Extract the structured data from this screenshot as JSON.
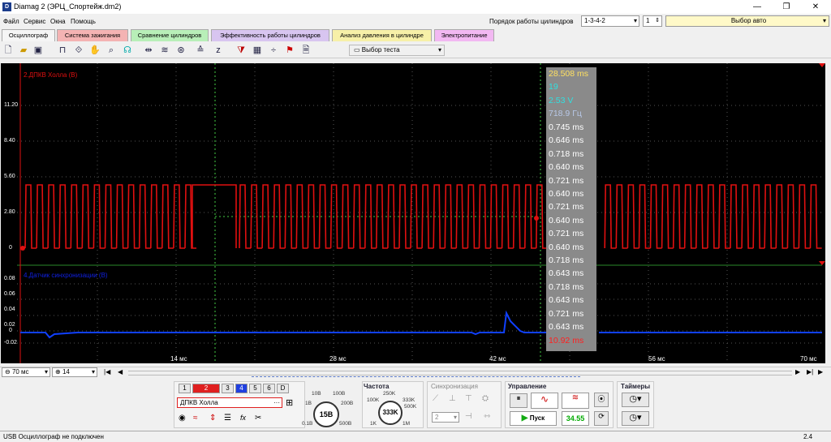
{
  "window": {
    "title": "Diamag 2 (ЭРЦ_Спортейж.dm2)",
    "icon": "diamag-app-icon"
  },
  "menu": [
    "Файл",
    "Сервис",
    "Окна",
    "Помощь"
  ],
  "cylinders": {
    "label": "Порядок работы цилиндров",
    "order": "1-3-4-2",
    "number": "1",
    "auto_select": "Выбор авто"
  },
  "tabs": [
    {
      "label": "Осциллограф",
      "color": "#f5f5f5",
      "active": true
    },
    {
      "label": "Система зажигания",
      "color": "#f4b3b3"
    },
    {
      "label": "Сравнение цилиндров",
      "color": "#b8efb8"
    },
    {
      "label": "Эффективность работы цилиндров",
      "color": "#d8c5f0"
    },
    {
      "label": "Анализ давления в цилиндре",
      "color": "#f7f0a8"
    },
    {
      "label": "Электропитание",
      "color": "#f2b8f2"
    }
  ],
  "toolbar": {
    "test_select": "Выбор теста"
  },
  "channels": {
    "ch2": {
      "label": "2.ДПКВ Холла (В)",
      "color": "#e01010",
      "yticks": [
        "11.20",
        "8.40",
        "5.60",
        "2.80",
        "0"
      ]
    },
    "ch4": {
      "label": "4.Датчик синхронизации (В)",
      "color": "#1020e0",
      "yticks": [
        "0.08",
        "0.06",
        "0.04",
        "0.02",
        "0",
        "-0.02"
      ]
    }
  },
  "xaxis": {
    "ticks": [
      "14 мс",
      "28 мс",
      "42 мс",
      "56 мс",
      "70 мс"
    ]
  },
  "measurements": {
    "time": "28.508 ms",
    "count": "19",
    "voltage": "2.53 V",
    "freq": "718.9 Гц",
    "periods": [
      "0.745 ms",
      "0.646 ms",
      "0.718 ms",
      "0.640 ms",
      "0.721 ms",
      "0.640 ms",
      "0.721 ms",
      "0.640 ms",
      "0.721 ms",
      "0.640 ms",
      "0.718 ms",
      "0.643 ms",
      "0.718 ms",
      "0.643 ms",
      "0.721 ms",
      "0.643 ms"
    ],
    "total": "10.92 ms"
  },
  "bottom": {
    "timebase": "70 мс",
    "position": "14"
  },
  "panel": {
    "channel_buttons": [
      "1",
      "2",
      "3",
      "4",
      "5",
      "6",
      "D"
    ],
    "channel_name": "ДПКВ Холла",
    "voltage_knob": {
      "value": "15В",
      "labels": [
        "10В",
        "100В",
        "1В",
        "200В",
        "0.1В",
        "500В"
      ]
    },
    "frequency": {
      "title": "Частота",
      "value": "333K",
      "labels": [
        "250K",
        "100K",
        "333K",
        "500K",
        "1K",
        "1M"
      ]
    },
    "sync": {
      "title": "Синхронизация",
      "value": "2"
    },
    "control": {
      "title": "Управление",
      "start": "Пуск",
      "counter": "34.55"
    },
    "timers": {
      "title": "Таймеры"
    }
  },
  "status": {
    "text": "USB Осциллограф не подключен",
    "version": "2.4"
  }
}
